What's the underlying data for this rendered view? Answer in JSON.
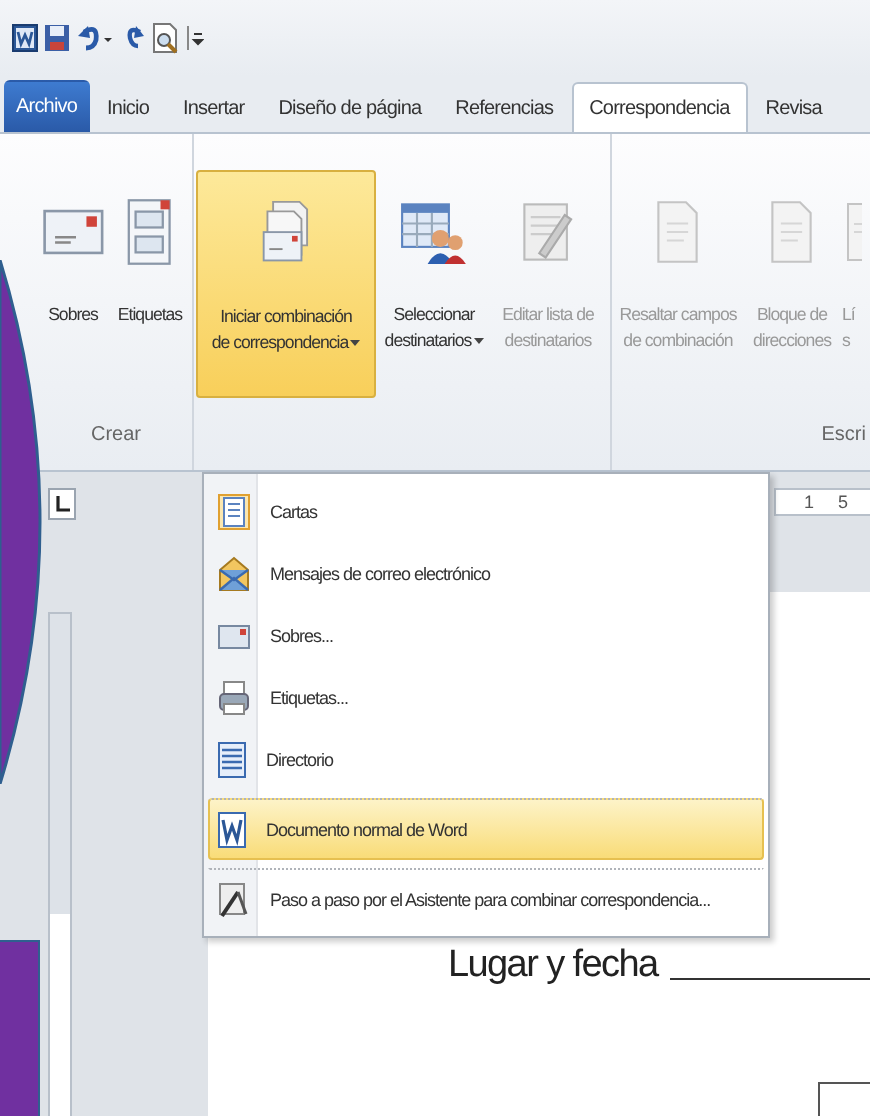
{
  "quick_access": {
    "items": [
      {
        "kind": "app"
      },
      {
        "kind": "save"
      },
      {
        "kind": "undo"
      },
      {
        "kind": "redo"
      },
      {
        "kind": "preview"
      },
      {
        "kind": "customize"
      }
    ]
  },
  "tabs": [
    {
      "label": "Archivo",
      "kind": "file",
      "selected": false
    },
    {
      "label": "Inicio",
      "kind": "tab",
      "selected": false
    },
    {
      "label": "Insertar",
      "kind": "tab",
      "selected": false
    },
    {
      "label": "Diseño de página",
      "kind": "tab",
      "selected": false
    },
    {
      "label": "Referencias",
      "kind": "tab",
      "selected": false
    },
    {
      "label": "Correspondencia",
      "kind": "tab",
      "selected": true
    },
    {
      "label": "Revisa",
      "kind": "tab",
      "selected": false
    }
  ],
  "ribbon": {
    "groups": [
      {
        "label": "Crear",
        "buttons": [
          {
            "kind": "envelope",
            "lines": [
              "Sobres"
            ],
            "dropdown": false,
            "disabled": false,
            "selected": false
          },
          {
            "kind": "labels",
            "lines": [
              "Etiquetas"
            ],
            "dropdown": false,
            "disabled": false,
            "selected": false
          }
        ]
      },
      {
        "buttons": [
          {
            "kind": "merge",
            "lines": [
              "Iniciar combinación",
              "de correspondencia"
            ],
            "dropdown": true,
            "disabled": false,
            "selected": true
          },
          {
            "kind": "recipients",
            "lines": [
              "Seleccionar",
              "destinatarios"
            ],
            "dropdown": true,
            "disabled": false,
            "selected": false
          },
          {
            "kind": "editlist",
            "lines": [
              "Editar lista de",
              "destinatarios"
            ],
            "dropdown": false,
            "disabled": true,
            "selected": false
          }
        ]
      },
      {
        "label": "Escri",
        "buttons": [
          {
            "kind": "doc",
            "lines": [
              "Resaltar campos",
              "de combinación"
            ],
            "dropdown": false,
            "disabled": true,
            "selected": false
          },
          {
            "kind": "doc",
            "lines": [
              "Bloque de",
              "direcciones"
            ],
            "dropdown": false,
            "disabled": true,
            "selected": false
          },
          {
            "kind": "doc_cut",
            "lines": [
              "Lí",
              "s"
            ],
            "dropdown": false,
            "disabled": true,
            "selected": false
          }
        ]
      }
    ]
  },
  "menu": {
    "items": [
      {
        "label": "Cartas",
        "kind": "letter",
        "selected": false,
        "separator_before": false
      },
      {
        "label": "Mensajes de correo electrónico",
        "kind": "email",
        "selected": false,
        "separator_before": false
      },
      {
        "label": "Sobres...",
        "kind": "envelope",
        "selected": false,
        "separator_before": false
      },
      {
        "label": "Etiquetas...",
        "kind": "labels",
        "selected": false,
        "separator_before": false
      },
      {
        "label": "Directorio",
        "kind": "directory",
        "selected": false,
        "separator_before": false
      },
      {
        "label": "Documento normal de Word",
        "kind": "word",
        "selected": true,
        "separator_before": true
      },
      {
        "label": "Paso a paso por el Asistente para combinar correspondencia...",
        "kind": "wizard",
        "selected": false,
        "separator_before": true
      }
    ]
  },
  "ruler": {
    "numbers": [
      "1",
      "5"
    ]
  },
  "document": {
    "text": "Lugar y fecha"
  }
}
